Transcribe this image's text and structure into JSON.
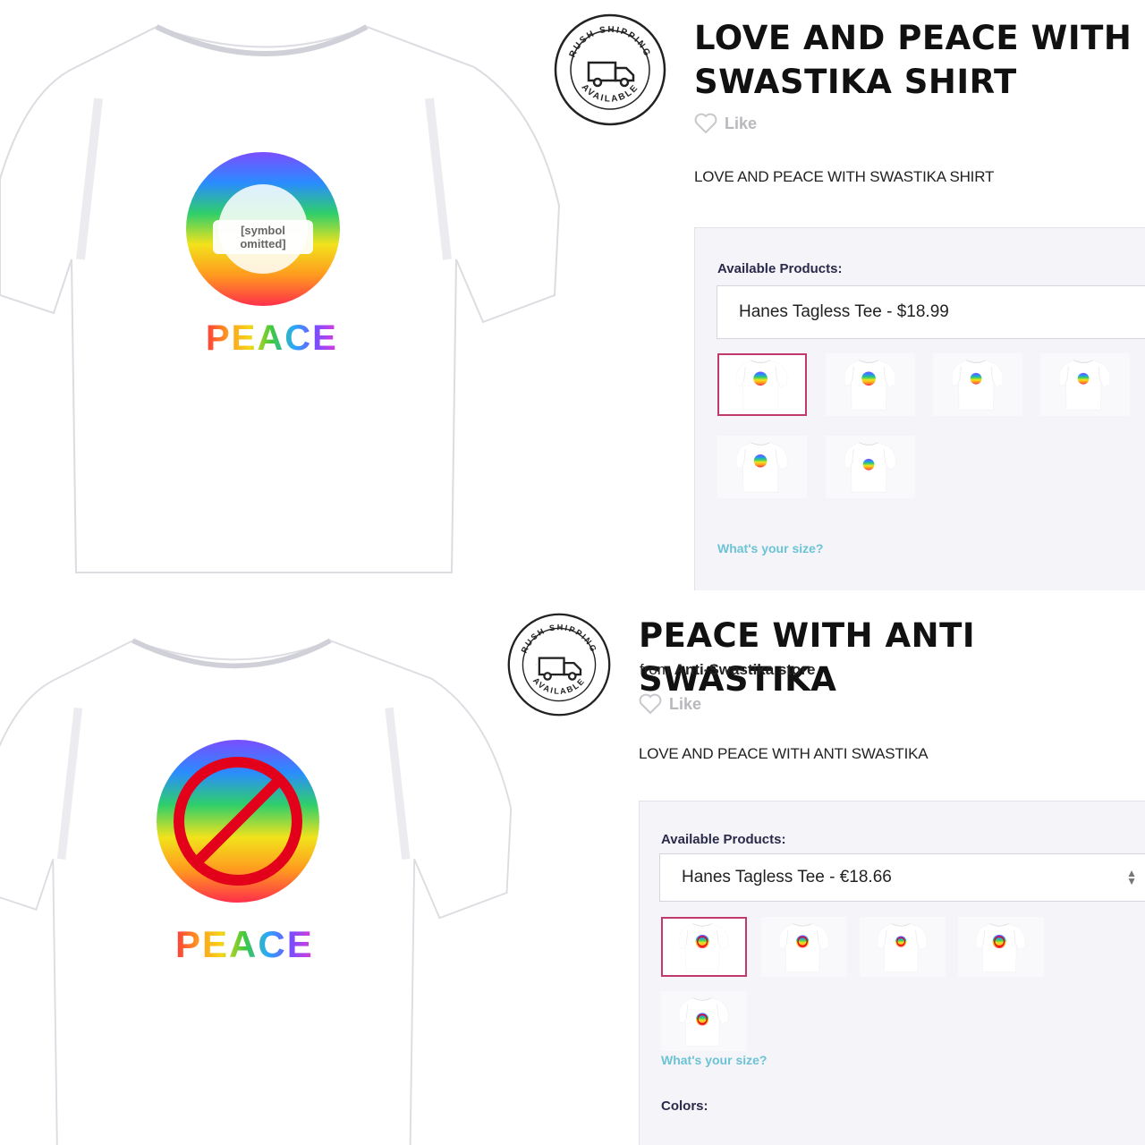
{
  "listing_top": {
    "title_line1": "LOVE AND PEACE WITH",
    "title_line2": "SWASTIKA SHIRT",
    "like_label": "Like",
    "description": "LOVE AND PEACE WITH SWASTIKA SHIRT",
    "available_label": "Available Products:",
    "selected_product": "Hanes Tagless Tee - $18.99",
    "size_link": "What's your size?",
    "print_text": "PEACE",
    "thumbnail_count": 6,
    "selected_thumbnail": 1
  },
  "listing_bottom": {
    "title": "PEACE WITH ANTI SWASTIKA",
    "from_prefix": "from",
    "store_name": "Anti-Swastika store",
    "like_label": "Like",
    "description": "LOVE AND PEACE WITH ANTI SWASTIKA",
    "available_label": "Available Products:",
    "selected_product": "Hanes Tagless Tee - €18.66",
    "size_link": "What's your size?",
    "colors_label": "Colors:",
    "print_text": "PEACE",
    "thumbnail_count": 5,
    "selected_thumbnail": 1
  },
  "badge": {
    "top_text": "RUSH SHIPPING",
    "bottom_text": "AVAILABLE"
  },
  "icons": {
    "like": "heart-outline-icon",
    "badge": "delivery-truck-icon",
    "select": "updown-arrows-icon"
  },
  "colors": {
    "accent_selected": "#c23a6d",
    "size_link": "#6cc3d5",
    "prohibition_red": "#e3001b",
    "box_bg": "#f5f4f8"
  },
  "omitted_symbol_note": "[symbol omitted]"
}
